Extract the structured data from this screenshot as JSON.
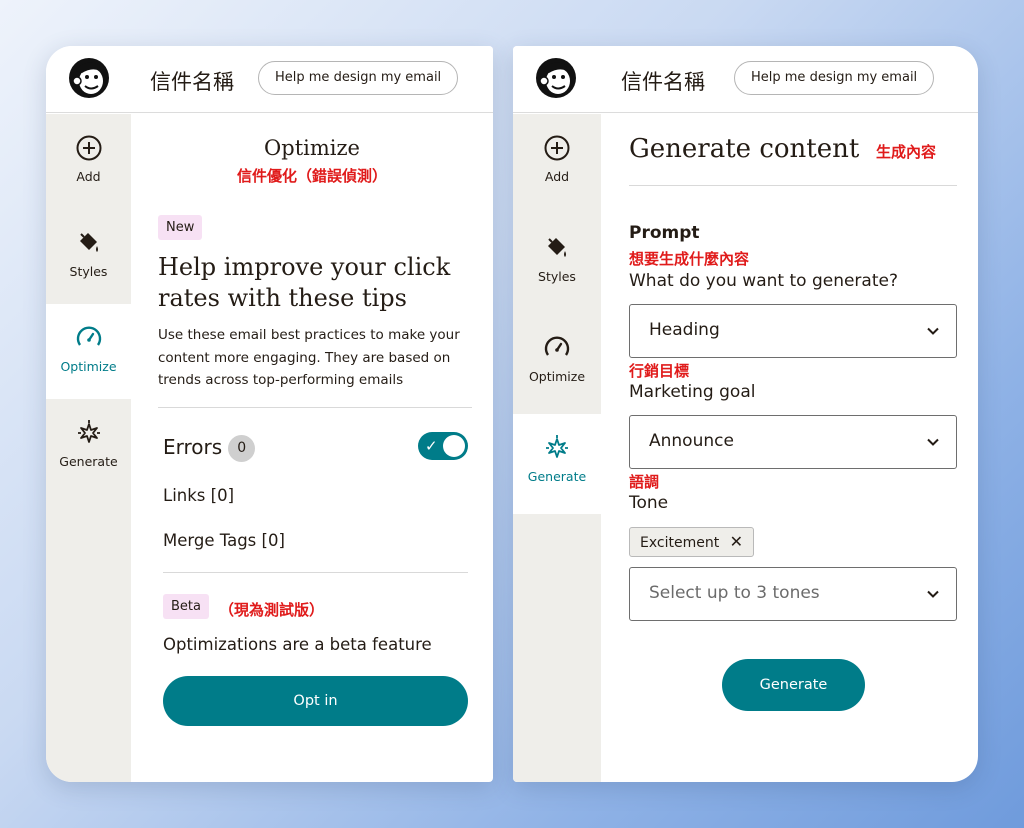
{
  "header": {
    "email_title": "信件名稱",
    "help_button": "Help me design my email"
  },
  "rail": {
    "items": [
      {
        "label": "Add",
        "icon": "plus-circle-icon"
      },
      {
        "label": "Styles",
        "icon": "paint-bucket-icon"
      },
      {
        "label": "Optimize",
        "icon": "gauge-icon"
      },
      {
        "label": "Generate",
        "icon": "sparkle-icon"
      }
    ]
  },
  "optimize": {
    "title": "Optimize",
    "title_cn": "信件優化（錯誤偵測）",
    "new_badge": "New",
    "heading": "Help improve your click rates with these tips",
    "description": "Use these email best practices to make your content more engaging. They are based on trends across top-performing emails",
    "errors_label": "Errors",
    "errors_count": "0",
    "errors_toggle_on": true,
    "links": "Links [0]",
    "merge_tags": "Merge Tags [0]",
    "beta_badge": "Beta",
    "beta_cn": "（現為測試版）",
    "beta_text": "Optimizations are a beta feature",
    "opt_in_button": "Opt in"
  },
  "generate": {
    "title": "Generate content",
    "title_cn": "生成內容",
    "prompt_label": "Prompt",
    "prompt_cn": "想要生成什麼內容",
    "prompt_question": "What do you want to generate?",
    "prompt_value": "Heading",
    "goal_cn": "行銷目標",
    "goal_label": "Marketing goal",
    "goal_value": "Announce",
    "tone_cn": "語調",
    "tone_label": "Tone",
    "tone_chip": "Excitement",
    "tone_placeholder": "Select up to 3 tones",
    "generate_button": "Generate"
  },
  "colors": {
    "accent": "#007c89",
    "annotation": "#e01b1b",
    "badge_bg": "#f7e1f4",
    "rail_bg": "#efeeea"
  }
}
